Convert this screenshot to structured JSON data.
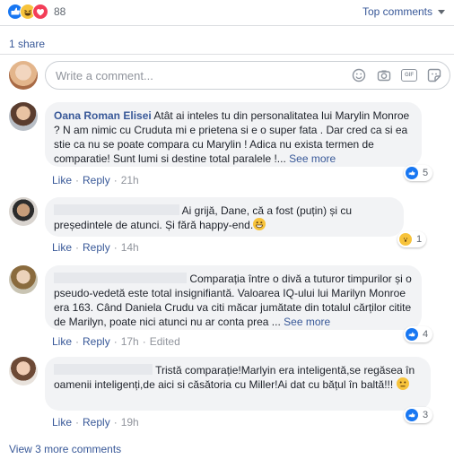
{
  "header": {
    "reaction_icons": [
      "like-icon",
      "haha-icon",
      "love-icon"
    ],
    "reaction_count": "88",
    "sort_label": "Top comments"
  },
  "shares_label": "1 share",
  "composer": {
    "placeholder": "Write a comment...",
    "icons": [
      "emoji-icon",
      "camera-icon",
      "gif-icon",
      "sticker-icon"
    ]
  },
  "comments": [
    {
      "author": "Oana Roman Elisei",
      "text": " Atât ai inteles tu din personalitatea lui Marylin Monroe ? N am nimic cu Cruduta mi e prietena si e o super fata . Dar cred ca si ea stie ca nu se poate compara cu Marylin ! Adica nu exista termen de comparatie! Sunt lumi si destine total paralele !...",
      "see_more": "See more",
      "like": "Like",
      "reply": "Reply",
      "time": "21h",
      "reaction_count": "5"
    },
    {
      "author": "",
      "text": "Ai grijă, Dane, că a fost (puțin) și cu președintele de atunci. Și fără happy-end.",
      "like": "Like",
      "reply": "Reply",
      "time": "14h",
      "reaction_count": "1"
    },
    {
      "author": "",
      "text_first": "Comparația între o divă a tuturor timpurilor și",
      "text": "o pseudo-vedetă este total insignifiantă. Valoarea IQ-ului lui Marilyn Monroe era 163. Când Daniela Crudu va citi măcar jumătate din totalul cărților citite de Marilyn, poate nici atunci nu ar conta prea ...",
      "see_more": "See more",
      "like": "Like",
      "reply": "Reply",
      "time": "17h",
      "edited": "Edited",
      "reaction_count": "4"
    },
    {
      "author": "",
      "text_first": "Tristă comparație!Marlyin era inteligentă,se regăsea în",
      "text": "oamenii inteligenți,de aici si căsătoria cu Miller!Ai dat cu bățul în baltă!!!",
      "like": "Like",
      "reply": "Reply",
      "time": "19h",
      "reaction_count": "3"
    }
  ],
  "view_more_label": "View 3 more comments",
  "colors": {
    "link": "#385898",
    "bubble": "#f2f3f5",
    "meta": "#90949c",
    "like_blue": "#1877f2"
  }
}
